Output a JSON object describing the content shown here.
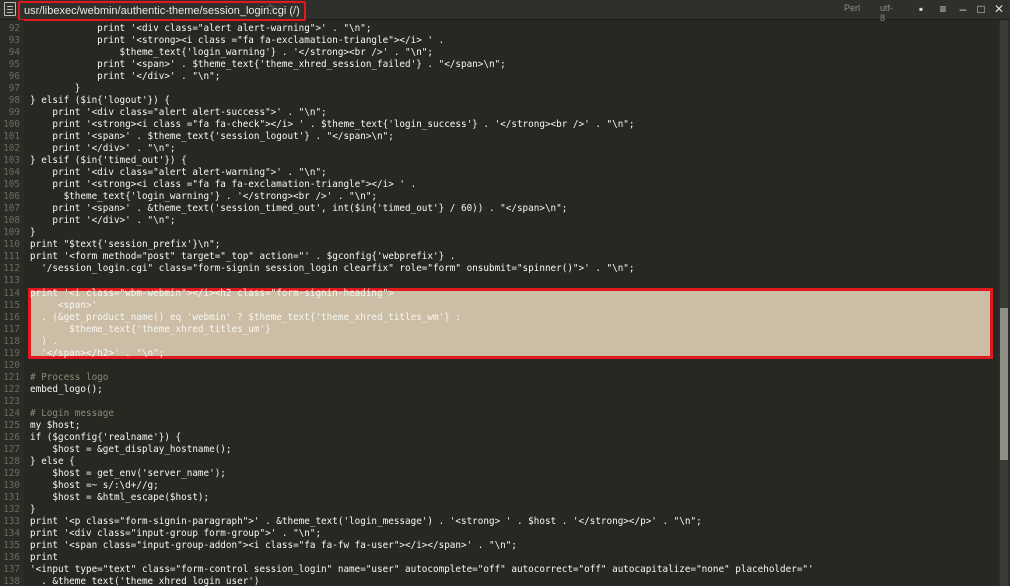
{
  "titlebar": {
    "path": "usr/libexec/webmin/authentic-theme/session_login.cgi (/)",
    "language": "Perl",
    "encoding": "utf-8",
    "icons": [
      "file-icon",
      "star-icon",
      "save-icon",
      "menu-icon",
      "minimize-icon",
      "maximize-icon",
      "close-icon"
    ]
  },
  "code": [
    {
      "n": "92",
      "t": "            print '<div class=\"alert alert-warning\">' . \"\\n\";"
    },
    {
      "n": "93",
      "t": "            print '<strong><i class =\"fa fa-exclamation-triangle\"></i> ' ."
    },
    {
      "n": "94",
      "t": "                $theme_text{'login_warning'} . '</strong><br />' . \"\\n\";"
    },
    {
      "n": "95",
      "t": "            print '<span>' . $theme_text{'theme_xhred_session_failed'} . \"</span>\\n\";"
    },
    {
      "n": "96",
      "t": "            print '</div>' . \"\\n\";"
    },
    {
      "n": "97",
      "t": "        }"
    },
    {
      "n": "98",
      "t": "} elsif ($in{'logout'}) {"
    },
    {
      "n": "99",
      "t": "    print '<div class=\"alert alert-success\">' . \"\\n\";"
    },
    {
      "n": "100",
      "t": "    print '<strong><i class =\"fa fa-check\"></i> ' . $theme_text{'login_success'} . '</strong><br />' . \"\\n\";"
    },
    {
      "n": "101",
      "t": "    print '<span>' . $theme_text{'session_logout'} . \"</span>\\n\";"
    },
    {
      "n": "102",
      "t": "    print '</div>' . \"\\n\";"
    },
    {
      "n": "103",
      "t": "} elsif ($in{'timed_out'}) {"
    },
    {
      "n": "104",
      "t": "    print '<div class=\"alert alert-warning\">' . \"\\n\";"
    },
    {
      "n": "105",
      "t": "    print '<strong><i class =\"fa fa fa-exclamation-triangle\"></i> ' ."
    },
    {
      "n": "106",
      "t": "      $theme_text{'login_warning'} . '</strong><br />' . \"\\n\";"
    },
    {
      "n": "107",
      "t": "    print '<span>' . &theme_text('session_timed_out', int($in{'timed_out'} / 60)) . \"</span>\\n\";"
    },
    {
      "n": "108",
      "t": "    print '</div>' . \"\\n\";"
    },
    {
      "n": "109",
      "t": "}"
    },
    {
      "n": "110",
      "t": "print \"$text{'session_prefix'}\\n\";"
    },
    {
      "n": "111",
      "t": "print '<form method=\"post\" target=\"_top\" action=\"' . $gconfig{'webprefix'} ."
    },
    {
      "n": "112",
      "t": "  '/session_login.cgi\" class=\"form-signin session_login clearfix\" role=\"form\" onsubmit=\"spinner()\">' . \"\\n\";"
    },
    {
      "n": "113",
      "t": ""
    },
    {
      "n": "114",
      "t": "print '<i class=\"wbm-webmin\"></i><h2 class=\"form-signin-heading\">"
    },
    {
      "n": "115",
      "t": "     <span>'"
    },
    {
      "n": "116",
      "t": "  . (&get_product_name() eq 'webmin' ? $theme_text{'theme_xhred_titles_wm'} :"
    },
    {
      "n": "117",
      "t": "       $theme_text{'theme_xhred_titles_um'}"
    },
    {
      "n": "118",
      "t": "  ) ."
    },
    {
      "n": "119",
      "t": "  '</span></h2>' . \"\\n\";"
    },
    {
      "n": "120",
      "t": ""
    },
    {
      "n": "121",
      "t": "# Process logo"
    },
    {
      "n": "122",
      "t": "embed_logo();"
    },
    {
      "n": "123",
      "t": ""
    },
    {
      "n": "124",
      "t": "# Login message"
    },
    {
      "n": "125",
      "t": "my $host;"
    },
    {
      "n": "126",
      "t": "if ($gconfig{'realname'}) {"
    },
    {
      "n": "127",
      "t": "    $host = &get_display_hostname();"
    },
    {
      "n": "128",
      "t": "} else {"
    },
    {
      "n": "129",
      "t": "    $host = get_env('server_name');"
    },
    {
      "n": "130",
      "t": "    $host =~ s/:\\d+//g;"
    },
    {
      "n": "131",
      "t": "    $host = &html_escape($host);"
    },
    {
      "n": "132",
      "t": "}"
    },
    {
      "n": "133",
      "t": "print '<p class=\"form-signin-paragraph\">' . &theme_text('login_message') . '<strong> ' . $host . '</strong></p>' . \"\\n\";"
    },
    {
      "n": "134",
      "t": "print '<div class=\"input-group form-group\">' . \"\\n\";"
    },
    {
      "n": "135",
      "t": "print '<span class=\"input-group-addon\"><i class=\"fa fa-fw fa-user\"></i></span>' . \"\\n\";"
    },
    {
      "n": "136",
      "t": "print"
    },
    {
      "n": "137",
      "t": "'<input type=\"text\" class=\"form-control session_login\" name=\"user\" autocomplete=\"off\" autocorrect=\"off\" autocapitalize=\"none\" placeholder=\"'"
    },
    {
      "n": "138",
      "t": "  . &theme_text('theme_xhred_login_user')"
    }
  ]
}
